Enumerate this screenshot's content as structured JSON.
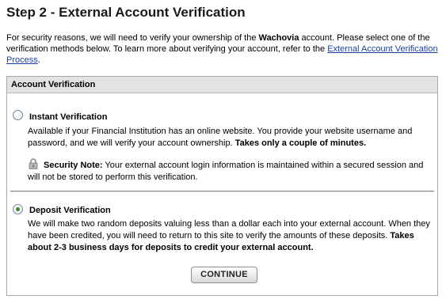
{
  "page": {
    "title": "Step 2 - External Account Verification"
  },
  "intro": {
    "part1": "For security reasons, we will need to verify your ownership of the ",
    "bank_name": "Wachovia",
    "part2": " account. Please select one of the verification methods below. To learn more about verifying your account, refer to the ",
    "link_text": "External Account Verification Process",
    "part3": "."
  },
  "panel": {
    "header": "Account Verification"
  },
  "options": {
    "instant": {
      "label": "Instant Verification",
      "selected": false,
      "desc_part1": "Available if your Financial Institution has an online website. You provide your website username and password, and we will verify your account ownership. ",
      "desc_bold": "Takes only a couple of minutes.",
      "security_title": "Security Note:",
      "security_text": " Your external account login information is maintained within a secured session and will not be stored to perform this verification."
    },
    "deposit": {
      "label": "Deposit Verification",
      "selected": true,
      "desc_part1": "We will make two random deposits valuing less than a dollar each into your external account. When they have been credited, you will need to return to this site to verify the amounts of these deposits. ",
      "desc_bold": "Takes about 2-3 business days for deposits to credit your external account."
    }
  },
  "actions": {
    "continue_label": "CONTINUE"
  },
  "icons": {
    "lock": "lock-icon",
    "radio": "radio-icon"
  },
  "colors": {
    "link": "#1a3fa0",
    "header_bg": "#e3e3e3",
    "selected_dot": "#3f8a2a"
  }
}
